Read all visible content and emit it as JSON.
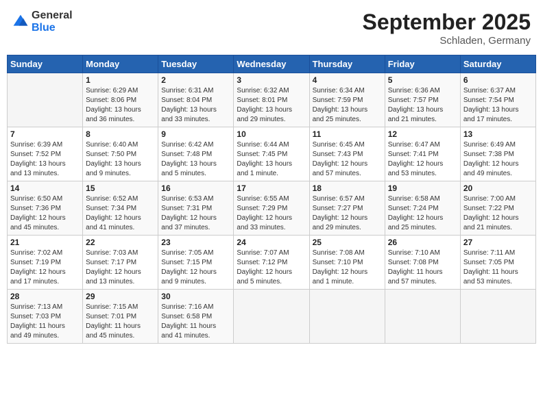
{
  "header": {
    "logo_general": "General",
    "logo_blue": "Blue",
    "month_title": "September 2025",
    "location": "Schladen, Germany"
  },
  "weekdays": [
    "Sunday",
    "Monday",
    "Tuesday",
    "Wednesday",
    "Thursday",
    "Friday",
    "Saturday"
  ],
  "weeks": [
    [
      {
        "day": "",
        "info": ""
      },
      {
        "day": "1",
        "info": "Sunrise: 6:29 AM\nSunset: 8:06 PM\nDaylight: 13 hours\nand 36 minutes."
      },
      {
        "day": "2",
        "info": "Sunrise: 6:31 AM\nSunset: 8:04 PM\nDaylight: 13 hours\nand 33 minutes."
      },
      {
        "day": "3",
        "info": "Sunrise: 6:32 AM\nSunset: 8:01 PM\nDaylight: 13 hours\nand 29 minutes."
      },
      {
        "day": "4",
        "info": "Sunrise: 6:34 AM\nSunset: 7:59 PM\nDaylight: 13 hours\nand 25 minutes."
      },
      {
        "day": "5",
        "info": "Sunrise: 6:36 AM\nSunset: 7:57 PM\nDaylight: 13 hours\nand 21 minutes."
      },
      {
        "day": "6",
        "info": "Sunrise: 6:37 AM\nSunset: 7:54 PM\nDaylight: 13 hours\nand 17 minutes."
      }
    ],
    [
      {
        "day": "7",
        "info": "Sunrise: 6:39 AM\nSunset: 7:52 PM\nDaylight: 13 hours\nand 13 minutes."
      },
      {
        "day": "8",
        "info": "Sunrise: 6:40 AM\nSunset: 7:50 PM\nDaylight: 13 hours\nand 9 minutes."
      },
      {
        "day": "9",
        "info": "Sunrise: 6:42 AM\nSunset: 7:48 PM\nDaylight: 13 hours\nand 5 minutes."
      },
      {
        "day": "10",
        "info": "Sunrise: 6:44 AM\nSunset: 7:45 PM\nDaylight: 13 hours\nand 1 minute."
      },
      {
        "day": "11",
        "info": "Sunrise: 6:45 AM\nSunset: 7:43 PM\nDaylight: 12 hours\nand 57 minutes."
      },
      {
        "day": "12",
        "info": "Sunrise: 6:47 AM\nSunset: 7:41 PM\nDaylight: 12 hours\nand 53 minutes."
      },
      {
        "day": "13",
        "info": "Sunrise: 6:49 AM\nSunset: 7:38 PM\nDaylight: 12 hours\nand 49 minutes."
      }
    ],
    [
      {
        "day": "14",
        "info": "Sunrise: 6:50 AM\nSunset: 7:36 PM\nDaylight: 12 hours\nand 45 minutes."
      },
      {
        "day": "15",
        "info": "Sunrise: 6:52 AM\nSunset: 7:34 PM\nDaylight: 12 hours\nand 41 minutes."
      },
      {
        "day": "16",
        "info": "Sunrise: 6:53 AM\nSunset: 7:31 PM\nDaylight: 12 hours\nand 37 minutes."
      },
      {
        "day": "17",
        "info": "Sunrise: 6:55 AM\nSunset: 7:29 PM\nDaylight: 12 hours\nand 33 minutes."
      },
      {
        "day": "18",
        "info": "Sunrise: 6:57 AM\nSunset: 7:27 PM\nDaylight: 12 hours\nand 29 minutes."
      },
      {
        "day": "19",
        "info": "Sunrise: 6:58 AM\nSunset: 7:24 PM\nDaylight: 12 hours\nand 25 minutes."
      },
      {
        "day": "20",
        "info": "Sunrise: 7:00 AM\nSunset: 7:22 PM\nDaylight: 12 hours\nand 21 minutes."
      }
    ],
    [
      {
        "day": "21",
        "info": "Sunrise: 7:02 AM\nSunset: 7:19 PM\nDaylight: 12 hours\nand 17 minutes."
      },
      {
        "day": "22",
        "info": "Sunrise: 7:03 AM\nSunset: 7:17 PM\nDaylight: 12 hours\nand 13 minutes."
      },
      {
        "day": "23",
        "info": "Sunrise: 7:05 AM\nSunset: 7:15 PM\nDaylight: 12 hours\nand 9 minutes."
      },
      {
        "day": "24",
        "info": "Sunrise: 7:07 AM\nSunset: 7:12 PM\nDaylight: 12 hours\nand 5 minutes."
      },
      {
        "day": "25",
        "info": "Sunrise: 7:08 AM\nSunset: 7:10 PM\nDaylight: 12 hours\nand 1 minute."
      },
      {
        "day": "26",
        "info": "Sunrise: 7:10 AM\nSunset: 7:08 PM\nDaylight: 11 hours\nand 57 minutes."
      },
      {
        "day": "27",
        "info": "Sunrise: 7:11 AM\nSunset: 7:05 PM\nDaylight: 11 hours\nand 53 minutes."
      }
    ],
    [
      {
        "day": "28",
        "info": "Sunrise: 7:13 AM\nSunset: 7:03 PM\nDaylight: 11 hours\nand 49 minutes."
      },
      {
        "day": "29",
        "info": "Sunrise: 7:15 AM\nSunset: 7:01 PM\nDaylight: 11 hours\nand 45 minutes."
      },
      {
        "day": "30",
        "info": "Sunrise: 7:16 AM\nSunset: 6:58 PM\nDaylight: 11 hours\nand 41 minutes."
      },
      {
        "day": "",
        "info": ""
      },
      {
        "day": "",
        "info": ""
      },
      {
        "day": "",
        "info": ""
      },
      {
        "day": "",
        "info": ""
      }
    ]
  ]
}
